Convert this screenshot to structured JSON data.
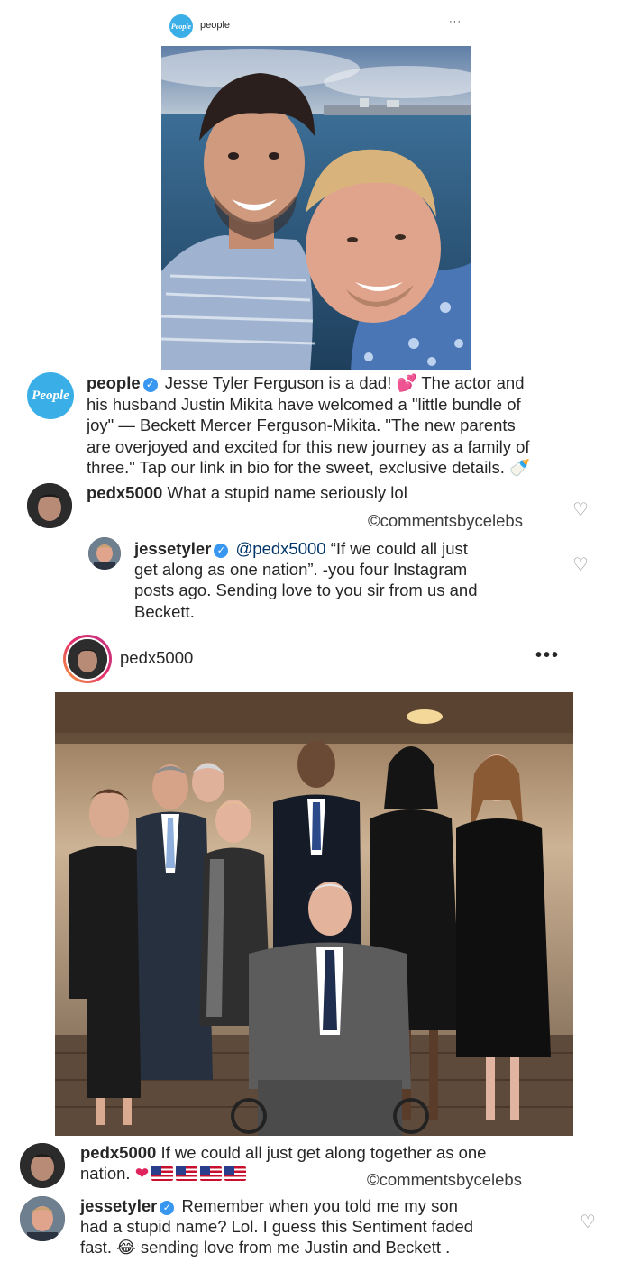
{
  "post1": {
    "header_avatar_text": "People",
    "header_username": "people",
    "more": "···",
    "caption": {
      "avatar_text": "People",
      "username": "people",
      "verified": "✓",
      "line1_a": "Jesse Tyler Ferguson is a dad!",
      "emoji_hearts": "💕",
      "line1_b": "The actor and",
      "line2": "his husband Justin Mikita have welcomed a \"little bundle of",
      "line3": "joy\" — Beckett Mercer Ferguson-Mikita. \"The new parents",
      "line4": "are overjoyed and excited for this new journey as a family of",
      "line5": "three.\" Tap our link in bio for the sweet, exclusive details.",
      "emoji_bottle": "🍼"
    },
    "comment1": {
      "username": "pedx5000",
      "text": "What a stupid name seriously lol",
      "watermark": "©commentsbycelebs"
    },
    "reply1": {
      "username": "jessetyler",
      "verified": "✓",
      "mention": "@pedx5000",
      "line1": "“If we could all just",
      "line2": "get along as one nation”. -you four Instagram",
      "line3": "posts ago. Sending love to you sir from us and",
      "line4": "Beckett."
    }
  },
  "post2": {
    "username": "pedx5000",
    "more": "•••",
    "caption": {
      "username": "pedx5000",
      "line1": "If we could all just get along together as one",
      "line2": "nation.",
      "heart": "❤",
      "watermark": "©commentsbycelebs"
    },
    "reply": {
      "username": "jessetyler",
      "verified": "✓",
      "line1": "Remember when you told me my son",
      "line2": "had a stupid name? Lol. I guess this Sentiment faded",
      "line3a": "fast.",
      "emoji": "😂",
      "line3b": "sending love from me Justin and Beckett ."
    }
  },
  "icons": {
    "heart_outline": "♡"
  },
  "colors": {
    "people_blue": "#3aaee7",
    "verified_blue": "#3897f0",
    "text": "#262626",
    "mention": "#003569"
  }
}
